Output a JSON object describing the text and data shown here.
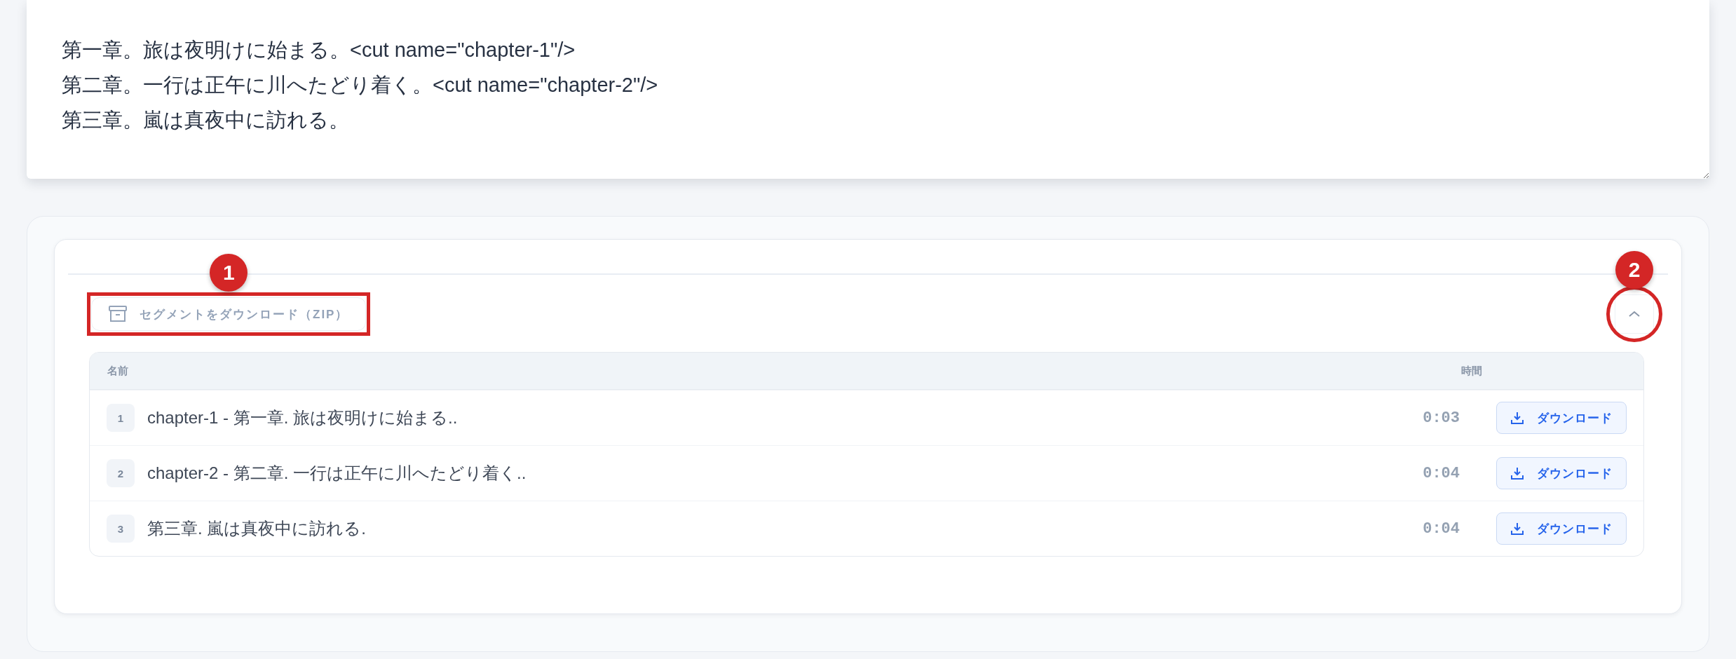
{
  "editor": {
    "lines": [
      "第一章。旅は夜明けに始まる。<cut name=\"chapter-1\"/>",
      "第二章。一行は正午に川へたどり着く。<cut name=\"chapter-2\"/>",
      "第三章。嵐は真夜中に訪れる。"
    ]
  },
  "zip_button": {
    "label": "セグメントをダウンロード（ZIP）",
    "callout": {
      "number": "1",
      "kind": "rectangle"
    }
  },
  "collapse_button": {
    "expanded": true,
    "callout": {
      "number": "2",
      "kind": "circle"
    }
  },
  "table": {
    "columns": [
      "名前",
      "時間"
    ],
    "rows": [
      {
        "index": "1",
        "name": "chapter-1 - 第一章. 旅は夜明けに始まる..",
        "time": "0:03",
        "action": "ダウンロード"
      },
      {
        "index": "2",
        "name": "chapter-2 - 第二章. 一行は正午に川へたどり着く..",
        "time": "0:04",
        "action": "ダウンロード"
      },
      {
        "index": "3",
        "name": "第三章. 嵐は真夜中に訪れる.",
        "time": "0:04",
        "action": "ダウンロード"
      }
    ]
  }
}
